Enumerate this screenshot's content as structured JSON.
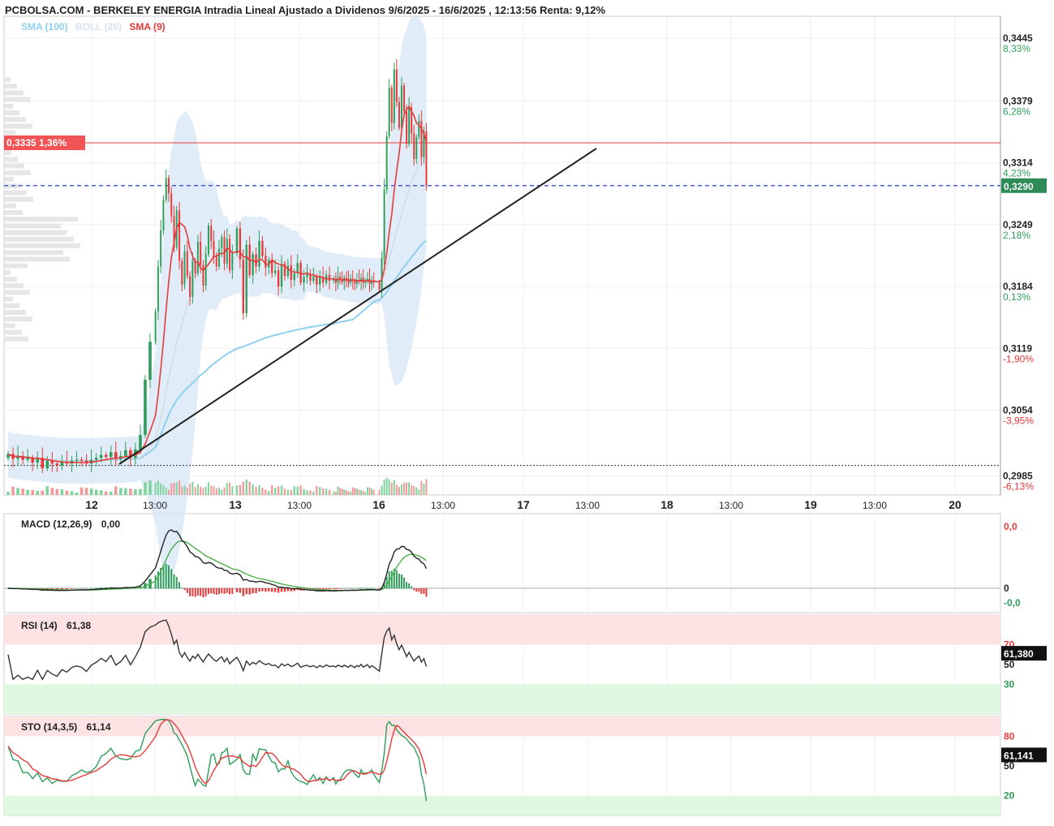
{
  "title": "PCBOLSA.COM - BERKELEY ENERGIA Intradia Lineal Ajustado a Dividenos 9/6/2025 - 16/6/2025 , 12:13:56 Renta: 9,12%",
  "legend": {
    "sma100": "SMA (100)",
    "boll": "BOLL (20)",
    "sma9": "SMA (9)",
    "colors": {
      "sma100": "#8fd0f0",
      "boll": "#dbe9f5",
      "sma9": "#e83a3a"
    }
  },
  "price_axis": {
    "ticks": [
      {
        "value": "0,3445",
        "pct": "8,33%",
        "pct_color": "#2e9e5b"
      },
      {
        "value": "0,3379",
        "pct": "6,28%",
        "pct_color": "#2e9e5b"
      },
      {
        "value": "0,3314",
        "pct": "4,23%",
        "pct_color": "#2e9e5b"
      },
      {
        "value": "0,3249",
        "pct": "2,18%",
        "pct_color": "#2e9e5b"
      },
      {
        "value": "0,3184",
        "pct": "0,13%",
        "pct_color": "#2e9e5b"
      },
      {
        "value": "0,3119",
        "pct": "-1,90%",
        "pct_color": "#e83a3a"
      },
      {
        "value": "0,3054",
        "pct": "-3,95%",
        "pct_color": "#e83a3a"
      },
      {
        "value": "0,2985",
        "pct": "-6,13%",
        "pct_color": "#e83a3a"
      }
    ],
    "last_price_badge": "0,3290",
    "ref_label": "0,3335",
    "ref_pct": "1,36%"
  },
  "time_axis": {
    "labels": [
      {
        "text": "12",
        "bold": true
      },
      {
        "text": "13:00",
        "bold": false
      },
      {
        "text": "13",
        "bold": true
      },
      {
        "text": "13:00",
        "bold": false
      },
      {
        "text": "16",
        "bold": true
      },
      {
        "text": "13:00",
        "bold": false
      },
      {
        "text": "17",
        "bold": true
      },
      {
        "text": "13:00",
        "bold": false
      },
      {
        "text": "18",
        "bold": true
      },
      {
        "text": "13:00",
        "bold": false
      },
      {
        "text": "19",
        "bold": true
      },
      {
        "text": "13:00",
        "bold": false
      },
      {
        "text": "20",
        "bold": true
      }
    ]
  },
  "macd": {
    "label": "MACD (12,26,9)",
    "value": "0,00",
    "axis": [
      {
        "text": "0,0",
        "color": "#e83a3a"
      },
      {
        "text": "0",
        "color": "#222222"
      },
      {
        "text": "-0,0",
        "color": "#2e9e5b"
      }
    ]
  },
  "rsi": {
    "label": "RSI (14)",
    "value": "61,38",
    "badge": "61,380",
    "axis": [
      {
        "text": "70",
        "color": "#e83a3a"
      },
      {
        "text": "50",
        "color": "#222222"
      },
      {
        "text": "30",
        "color": "#2e9e5b"
      }
    ]
  },
  "sto": {
    "label": "STO (14,3,5)",
    "value": "61,14",
    "badge": "61,141",
    "axis": [
      {
        "text": "80",
        "color": "#e83a3a"
      },
      {
        "text": "50",
        "color": "#222222"
      },
      {
        "text": "20",
        "color": "#2e9e5b"
      }
    ]
  },
  "chart_data": {
    "type": "candlestick",
    "title": "PCBOLSA.COM - BERKELEY ENERGIA Intradia Lineal Ajustado a Dividenos 9/6/2025 - 16/6/2025 , 12:13:56 Renta: 9,12%",
    "ylim": [
      0.2965,
      0.3468
    ],
    "last_price": 0.329,
    "reference_price": 0.3335,
    "support_level": 0.2996,
    "trendline": [
      [
        0.2985,
        "start"
      ],
      [
        0.3335,
        "end"
      ]
    ],
    "colors": {
      "up": "#2e9e5b",
      "down": "#e83a3a",
      "grid": "#ececec"
    },
    "segments": [
      {
        "day": "12",
        "closes": [
          0.3008,
          0.3003,
          0.3006,
          0.3002,
          0.3004,
          0.2999,
          0.3004,
          0.2993,
          0.3001,
          0.2998,
          0.2996,
          0.3,
          0.2998,
          0.3001,
          0.3002,
          0.3001,
          0.2998,
          0.3002,
          0.3004,
          0.3007,
          0.3005,
          0.301,
          0.3003,
          0.3006,
          0.3012,
          0.3004,
          0.3013,
          0.3028,
          0.3086,
          0.3126
        ]
      },
      {
        "day": "12pm",
        "closes": [
          0.3158,
          0.3205,
          0.3243,
          0.3275,
          0.3298,
          0.3282,
          0.3258,
          0.3225,
          0.3264,
          0.3211,
          0.3186,
          0.3221,
          0.3195,
          0.3173,
          0.3211,
          0.3198,
          0.3231,
          0.3207,
          0.3185,
          0.3218,
          0.3248,
          0.3232,
          0.3215,
          0.3205,
          0.3224,
          0.3236,
          0.3208,
          0.3234,
          0.3201,
          0.3219
        ]
      },
      {
        "day": "13",
        "closes": [
          0.3245,
          0.3212,
          0.3156,
          0.3228,
          0.3196,
          0.3218,
          0.3205,
          0.3232,
          0.3216,
          0.3204,
          0.3212,
          0.3198,
          0.3201,
          0.3184,
          0.3208,
          0.3195,
          0.3206,
          0.3191,
          0.3198,
          0.3209,
          0.3188,
          0.3194,
          0.3197,
          0.319,
          0.3195,
          0.3186,
          0.3194,
          0.3188,
          0.3196,
          0.319
        ]
      },
      {
        "day": "13pm",
        "closes": [
          0.3192,
          0.3188,
          0.3194,
          0.3191,
          0.3189,
          0.3193,
          0.319,
          0.3188,
          0.3192,
          0.319,
          0.3187,
          0.3191,
          0.3189,
          0.3193,
          0.3188,
          0.319,
          0.3192,
          0.3187,
          0.319,
          0.3188
        ]
      },
      {
        "day": "16",
        "closes": [
          0.3181,
          0.3214,
          0.3286,
          0.3342,
          0.3393,
          0.3356,
          0.3412,
          0.3378,
          0.3351,
          0.3395,
          0.3368,
          0.3334,
          0.3372,
          0.3345,
          0.3318,
          0.3341,
          0.3358,
          0.332,
          0.3347,
          0.329
        ]
      }
    ],
    "volume_note": "volume bars under candles (green up, red down)",
    "macd": {
      "ylim": [
        -0.0025,
        0.0135
      ]
    },
    "rsi": {
      "ylim": [
        0,
        100
      ],
      "last": 61.38
    },
    "sto": {
      "ylim": [
        0,
        100
      ],
      "k_last": 61.14
    }
  }
}
